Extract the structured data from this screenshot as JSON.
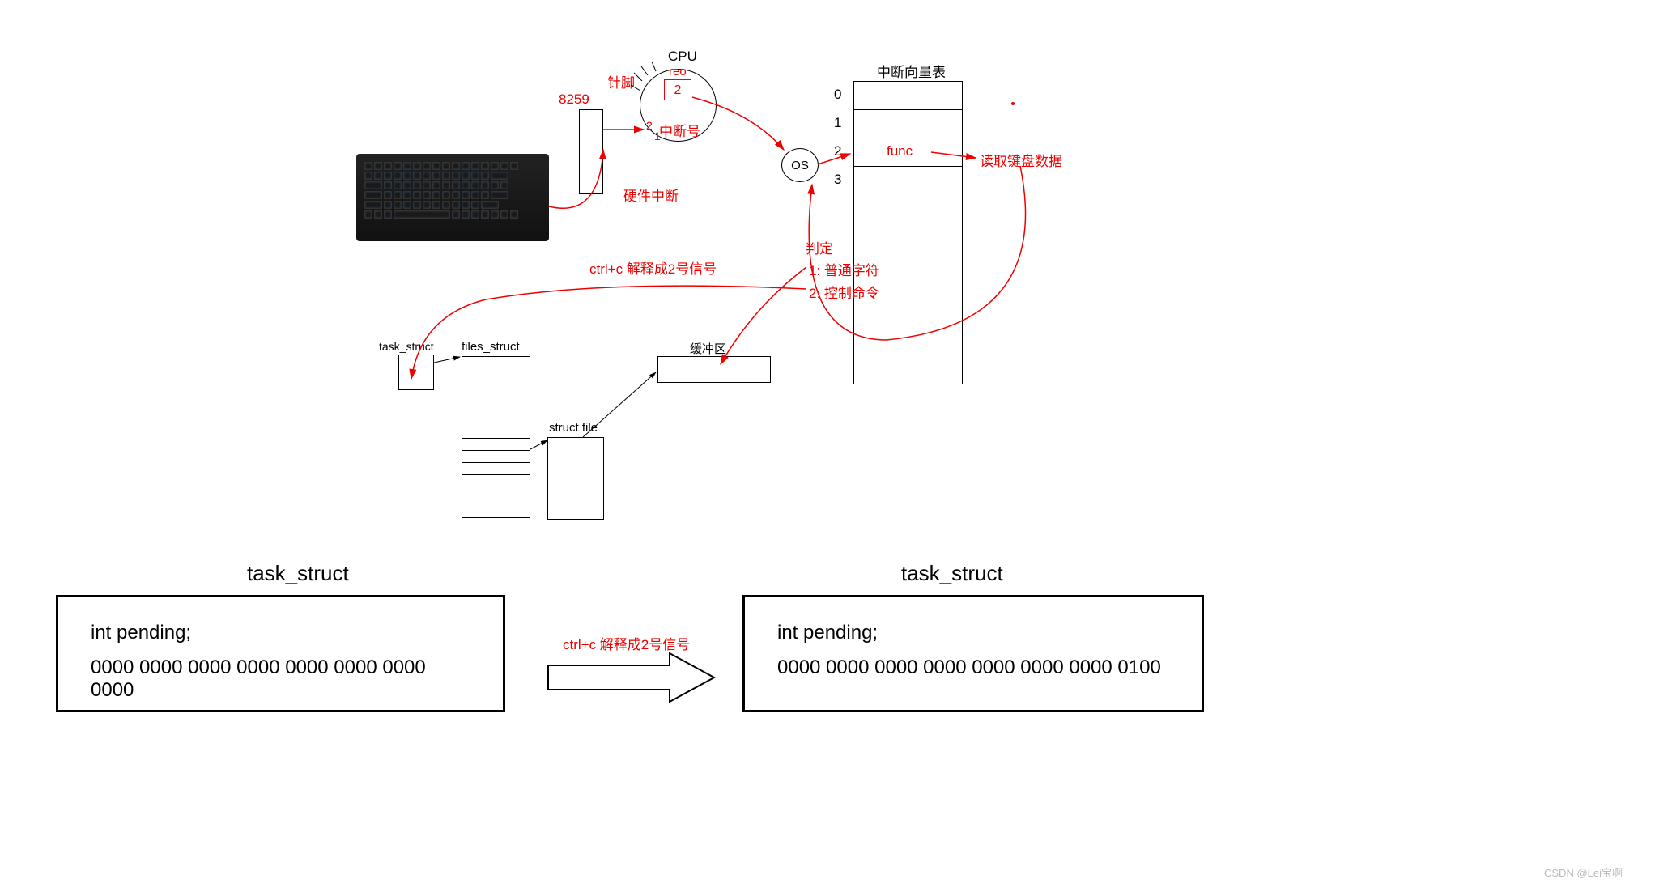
{
  "top": {
    "cpu_label": "CPU",
    "pin_label": "针脚",
    "reo_label": "reo",
    "reo_value": "2",
    "chip_label": "8259",
    "interrupt_num_label": "中断号",
    "interrupt_num_1": "1",
    "interrupt_num_2": "2",
    "hw_interrupt_label": "硬件中断",
    "os_label": "OS",
    "vector_table_title": "中断向量表",
    "vector_indices": [
      "0",
      "1",
      "2",
      "3"
    ],
    "func_label": "func",
    "read_kb_label": "读取键盘数据",
    "judge_label": "判定",
    "case1_label": "1:  普通字符",
    "case2_label": "2:  控制命令",
    "ctrlc_label": "ctrl+c 解释成2号信号"
  },
  "mid": {
    "task_struct_label": "task_struct",
    "files_struct_label": "files_struct",
    "struct_file_label": "struct file",
    "buffer_label": "缓冲区"
  },
  "bottom": {
    "left_title": "task_struct",
    "right_title": "task_struct",
    "pending_label": "int pending;",
    "left_bits": "0000 0000 0000 0000 0000 0000 0000 0000",
    "right_bits": "0000 0000 0000 0000 0000 0000 0000  0100",
    "arrow_label": "ctrl+c 解释成2号信号"
  },
  "watermark": "CSDN @Lei宝啊"
}
